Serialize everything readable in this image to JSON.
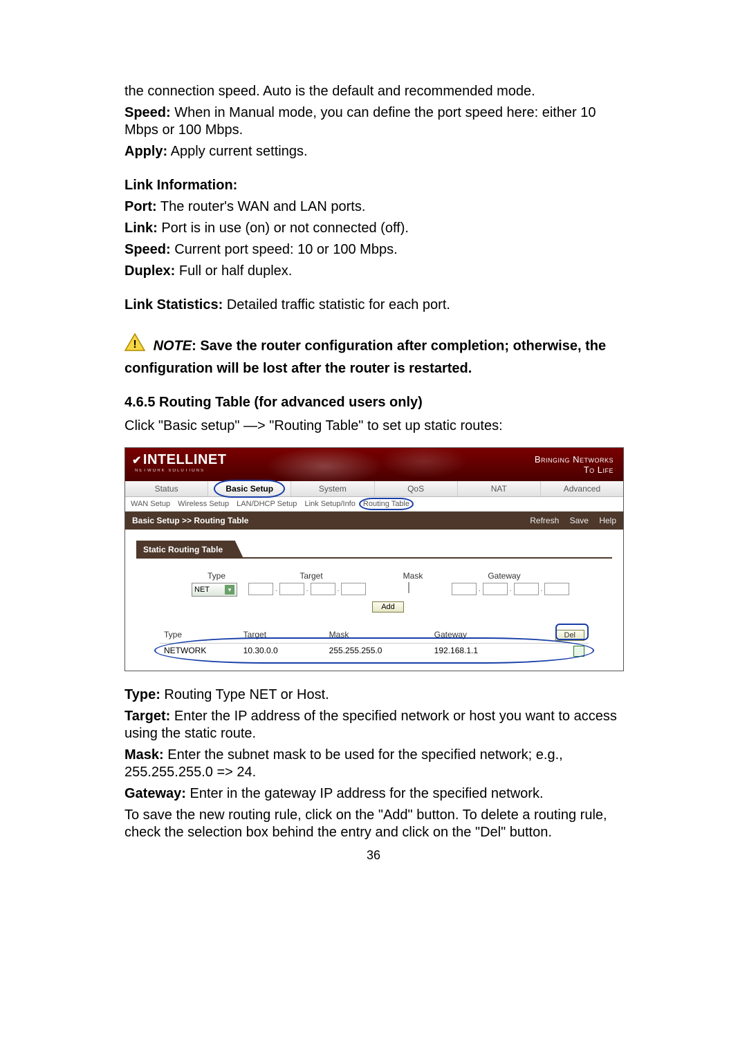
{
  "intro": {
    "line1": "the connection speed. Auto is the default and recommended mode.",
    "speed_label": "Speed:",
    "speed_text": " When in Manual mode, you can define the port speed here: either 10 Mbps or 100 Mbps.",
    "apply_label": "Apply:",
    "apply_text": " Apply current settings."
  },
  "link_info": {
    "title": "Link Information:",
    "port_label": "Port:",
    "port_text": " The router's WAN and LAN ports.",
    "link_label": "Link:",
    "link_text": " Port is in use (on) or not connected (off).",
    "speed_label": "Speed:",
    "speed_text": " Current port speed: 10 or 100 Mbps.",
    "duplex_label": "Duplex:",
    "duplex_text": " Full or half duplex."
  },
  "link_stats": {
    "label": "Link Statistics:",
    "text": " Detailed traffic statistic for each port."
  },
  "note": {
    "label": "NOTE",
    "text": ": Save the router configuration after completion; otherwise, the configuration will be lost after the router is restarted."
  },
  "section": {
    "title": "4.6.5 Routing Table (for advanced users only)",
    "instr": "Click \"Basic setup\" —> \"Routing Table\" to set up static routes:"
  },
  "router": {
    "brand": "INTELLINET",
    "brand_sub": "NETWORK SOLUTIONS",
    "brand_tag1": "Bringing Networks",
    "brand_tag2": "To Life",
    "tabs": [
      "Status",
      "Basic Setup",
      "System",
      "QoS",
      "NAT",
      "Advanced"
    ],
    "subtabs": [
      "WAN Setup",
      "Wireless Setup",
      "LAN/DHCP Setup",
      "Link Setup/Info",
      "Routing Table"
    ],
    "crumb": "Basic Setup >> Routing Table",
    "actions": {
      "refresh": "Refresh",
      "save": "Save",
      "help": "Help"
    },
    "panel_title": "Static Routing Table",
    "form_labels": {
      "type": "Type",
      "target": "Target",
      "mask": "Mask",
      "gateway": "Gateway"
    },
    "type_value": "NET",
    "add_label": "Add",
    "table": {
      "head": {
        "type": "Type",
        "target": "Target",
        "mask": "Mask",
        "gateway": "Gateway",
        "del": "Del"
      },
      "row": {
        "type": "NETWORK",
        "target": "10.30.0.0",
        "mask": "255.255.255.0",
        "gateway": "192.168.1.1"
      }
    }
  },
  "defs": {
    "type_label": "Type:",
    "type_text": " Routing Type NET or Host.",
    "target_label": "Target:",
    "target_text": " Enter the IP address of the specified network or host you want to access using the static route.",
    "mask_label": "Mask:",
    "mask_text": " Enter the subnet mask to be used for the specified network; e.g., 255.255.255.0 => 24.",
    "gateway_label": "Gateway:",
    "gateway_text": " Enter in the gateway IP address for the specified network.",
    "footer": "To save the new routing rule, click on the \"Add\" button. To delete a routing rule, check the selection box behind the entry and click on the \"Del\" button."
  },
  "page_number": "36"
}
